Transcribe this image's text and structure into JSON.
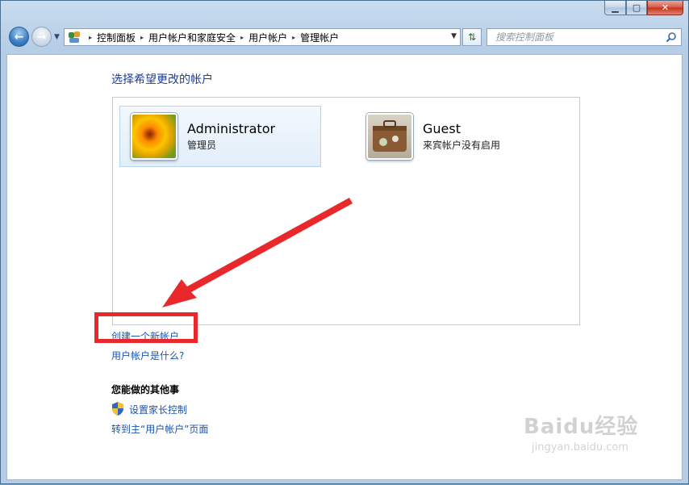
{
  "window": {
    "minimize_label": "▁",
    "maximize_label": "▢",
    "close_label": "✕"
  },
  "navigation": {
    "back_icon": "back-arrow",
    "forward_icon": "forward-arrow",
    "breadcrumbs": [
      "控制面板",
      "用户帐户和家庭安全",
      "用户帐户",
      "管理帐户"
    ],
    "breadcrumb_separator": "▸",
    "refresh_icon": "refresh-icon"
  },
  "search": {
    "placeholder": "搜索控制面板"
  },
  "main": {
    "heading": "选择希望更改的帐户",
    "accounts": [
      {
        "name": "Administrator",
        "description": "管理员",
        "picture": "flower",
        "selected": true
      },
      {
        "name": "Guest",
        "description": "来宾帐户没有启用",
        "picture": "suitcase",
        "selected": false
      }
    ],
    "links": {
      "create_account": "创建一个新帐户",
      "what_is_account": "用户帐户是什么?"
    },
    "other_section": {
      "heading": "您能做的其他事",
      "parental_controls": "设置家长控制",
      "goto_user_accounts": "转到主“用户帐户”页面"
    }
  },
  "annotation": {
    "color": "#e8282a"
  },
  "watermark": {
    "logo_text": "Baidu经验",
    "url": "jingyan.baidu.com"
  }
}
